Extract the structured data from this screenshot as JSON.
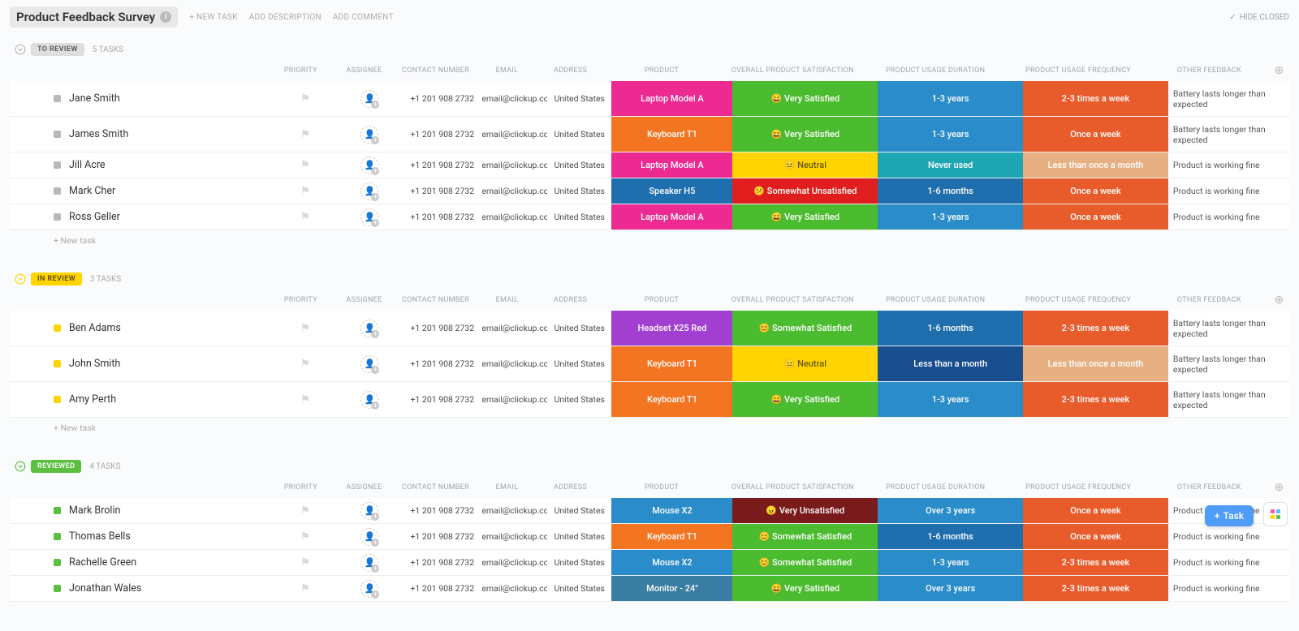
{
  "header": {
    "title": "Product Feedback Survey",
    "new_task": "+ NEW TASK",
    "add_description": "ADD DESCRIPTION",
    "add_comment": "ADD COMMENT",
    "hide_closed": "HIDE CLOSED"
  },
  "columns": {
    "priority": "PRIORITY",
    "assignee": "ASSIGNEE",
    "contact": "CONTACT NUMBER",
    "email": "EMAIL",
    "address": "ADDRESS",
    "product": "PRODUCT",
    "satisfaction": "OVERALL PRODUCT SATISFACTION",
    "duration": "PRODUCT USAGE DURATION",
    "frequency": "PRODUCT USAGE FREQUENCY",
    "feedback": "OTHER FEEDBACK"
  },
  "new_task_row": "+ New task",
  "fab_label": "Task",
  "palette": {
    "to_review": "#dedede",
    "in_review": "#ffd400",
    "reviewed": "#5bbf3f",
    "dot_to_review": "#b8b8b8",
    "dot_in_review": "#ffd400",
    "dot_reviewed": "#5bbf3f",
    "pink": "#ed2a92",
    "orange": "#f37522",
    "green": "#4bbb2f",
    "yellow": "#ffd400",
    "red": "#e01e1e",
    "darkred": "#7a1b1b",
    "blue": "#2a8cc9",
    "midblue": "#1f6fae",
    "darkblue": "#1a4f8f",
    "teal": "#1ea7b3",
    "steel": "#3b7ea3",
    "burnt": "#e85c2c",
    "tan": "#e6b083",
    "purple": "#a03fd0"
  },
  "groups": [
    {
      "status_label": "TO REVIEW",
      "status_key": "to_review",
      "count_label": "5 TASKS",
      "toggle_color": "#bbb",
      "rows": [
        {
          "name": "Jane Smith",
          "contact": "+1 201 908 2732",
          "email": "email@clickup.cc",
          "address": "United States",
          "product": {
            "text": "Laptop Model A",
            "color": "pink"
          },
          "satisfaction": {
            "text": "😄 Very Satisfied",
            "color": "green"
          },
          "duration": {
            "text": "1-3 years",
            "color": "blue"
          },
          "frequency": {
            "text": "2-3 times a week",
            "color": "burnt"
          },
          "feedback": "Battery lasts longer than expected"
        },
        {
          "name": "James Smith",
          "contact": "+1 201 908 2732",
          "email": "email@clickup.cc",
          "address": "United States",
          "product": {
            "text": "Keyboard T1",
            "color": "orange"
          },
          "satisfaction": {
            "text": "😄 Very Satisfied",
            "color": "green"
          },
          "duration": {
            "text": "1-3 years",
            "color": "blue"
          },
          "frequency": {
            "text": "Once a week",
            "color": "burnt"
          },
          "feedback": "Battery lasts longer than expected"
        },
        {
          "name": "Jill Acre",
          "contact": "+1 201 908 2732",
          "email": "email@clickup.cc",
          "address": "United States",
          "product": {
            "text": "Laptop Model A",
            "color": "pink"
          },
          "satisfaction": {
            "text": "😐 Neutral",
            "color": "yellow"
          },
          "duration": {
            "text": "Never used",
            "color": "teal"
          },
          "frequency": {
            "text": "Less than once a month",
            "color": "tan"
          },
          "feedback": "Product is working fine"
        },
        {
          "name": "Mark Cher",
          "contact": "+1 201 908 2732",
          "email": "email@clickup.cc",
          "address": "United States",
          "product": {
            "text": "Speaker H5",
            "color": "midblue"
          },
          "satisfaction": {
            "text": "😕 Somewhat Unsatisfied",
            "color": "red"
          },
          "duration": {
            "text": "1-6 months",
            "color": "midblue"
          },
          "frequency": {
            "text": "Once a week",
            "color": "burnt"
          },
          "feedback": "Product is working fine"
        },
        {
          "name": "Ross Geller",
          "contact": "+1 201 908 2732",
          "email": "email@clickup.cc",
          "address": "United States",
          "product": {
            "text": "Laptop Model A",
            "color": "pink"
          },
          "satisfaction": {
            "text": "😄 Very Satisfied",
            "color": "green"
          },
          "duration": {
            "text": "1-3 years",
            "color": "blue"
          },
          "frequency": {
            "text": "Once a week",
            "color": "burnt"
          },
          "feedback": "Product is working fine"
        }
      ]
    },
    {
      "status_label": "IN REVIEW",
      "status_key": "in_review",
      "count_label": "3 TASKS",
      "toggle_color": "#ffd400",
      "rows": [
        {
          "name": "Ben Adams",
          "contact": "+1 201 908 2732",
          "email": "email@clickup.cc",
          "address": "United States",
          "product": {
            "text": "Headset X25 Red",
            "color": "purple"
          },
          "satisfaction": {
            "text": "😊 Somewhat Satisfied",
            "color": "green"
          },
          "duration": {
            "text": "1-6 months",
            "color": "midblue"
          },
          "frequency": {
            "text": "2-3 times a week",
            "color": "burnt"
          },
          "feedback": "Battery lasts longer than expected"
        },
        {
          "name": "John Smith",
          "contact": "+1 201 908 2732",
          "email": "email@clickup.cc",
          "address": "United States",
          "product": {
            "text": "Keyboard T1",
            "color": "orange"
          },
          "satisfaction": {
            "text": "😐 Neutral",
            "color": "yellow"
          },
          "duration": {
            "text": "Less than a month",
            "color": "darkblue"
          },
          "frequency": {
            "text": "Less than once a month",
            "color": "tan"
          },
          "feedback": "Battery lasts longer than expected"
        },
        {
          "name": "Amy Perth",
          "contact": "+1 201 908 2732",
          "email": "email@clickup.cc",
          "address": "United States",
          "product": {
            "text": "Keyboard T1",
            "color": "orange"
          },
          "satisfaction": {
            "text": "😄 Very Satisfied",
            "color": "green"
          },
          "duration": {
            "text": "1-3 years",
            "color": "blue"
          },
          "frequency": {
            "text": "2-3 times a week",
            "color": "burnt"
          },
          "feedback": "Battery lasts longer than expected"
        }
      ]
    },
    {
      "status_label": "REVIEWED",
      "status_key": "reviewed",
      "count_label": "4 TASKS",
      "toggle_color": "#5bbf3f",
      "rows": [
        {
          "name": "Mark Brolin",
          "contact": "+1 201 908 2732",
          "email": "email@clickup.cc",
          "address": "United States",
          "product": {
            "text": "Mouse X2",
            "color": "blue"
          },
          "satisfaction": {
            "text": "😠 Very Unsatisfied",
            "color": "darkred"
          },
          "duration": {
            "text": "Over 3 years",
            "color": "blue"
          },
          "frequency": {
            "text": "Once a week",
            "color": "burnt"
          },
          "feedback": "Product is working fine"
        },
        {
          "name": "Thomas Bells",
          "contact": "+1 201 908 2732",
          "email": "email@clickup.cc",
          "address": "United States",
          "product": {
            "text": "Keyboard T1",
            "color": "orange"
          },
          "satisfaction": {
            "text": "😊 Somewhat Satisfied",
            "color": "green"
          },
          "duration": {
            "text": "1-6 months",
            "color": "midblue"
          },
          "frequency": {
            "text": "Once a week",
            "color": "burnt"
          },
          "feedback": "Product is working fine"
        },
        {
          "name": "Rachelle Green",
          "contact": "+1 201 908 2732",
          "email": "email@clickup.cc",
          "address": "United States",
          "product": {
            "text": "Mouse X2",
            "color": "blue"
          },
          "satisfaction": {
            "text": "😊 Somewhat Satisfied",
            "color": "green"
          },
          "duration": {
            "text": "1-3 years",
            "color": "blue"
          },
          "frequency": {
            "text": "2-3 times a week",
            "color": "burnt"
          },
          "feedback": "Product is working fine"
        },
        {
          "name": "Jonathan Wales",
          "contact": "+1 201 908 2732",
          "email": "email@clickup.cc",
          "address": "United States",
          "product": {
            "text": "Monitor - 24\"",
            "color": "steel"
          },
          "satisfaction": {
            "text": "😄 Very Satisfied",
            "color": "green"
          },
          "duration": {
            "text": "Over 3 years",
            "color": "blue"
          },
          "frequency": {
            "text": "2-3 times a week",
            "color": "burnt"
          },
          "feedback": "Product is working fine"
        }
      ]
    }
  ]
}
